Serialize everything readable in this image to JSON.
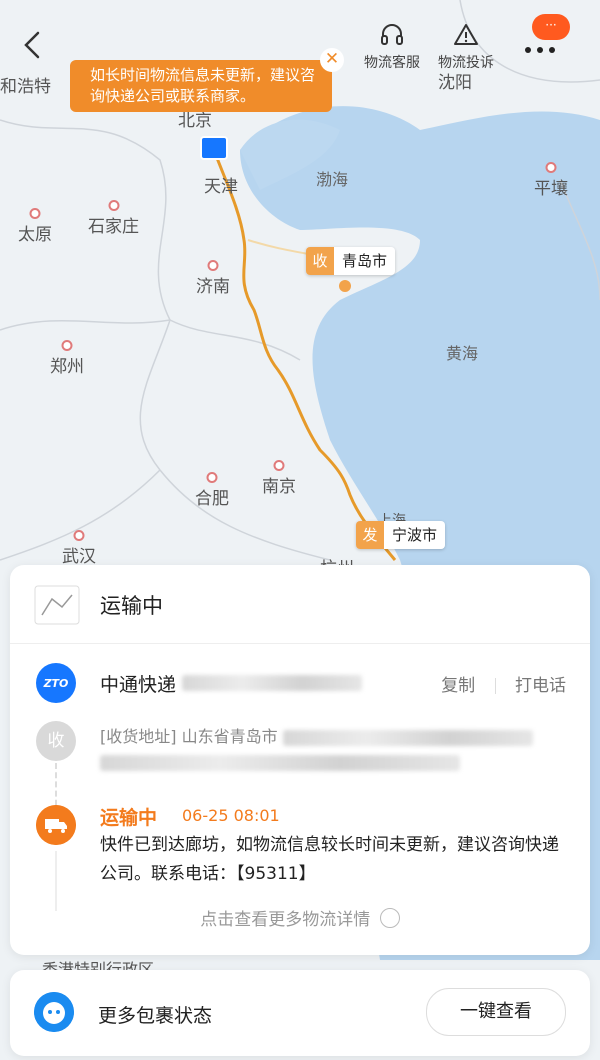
{
  "header": {
    "back_icon": "chevron-left-icon",
    "customer_service_label": "物流客服",
    "complaint_label": "物流投诉",
    "more_badge": "···"
  },
  "toast": {
    "message": "如长时间物流信息未更新，建议咨询快递公司或联系商家。",
    "close_icon": "close-icon"
  },
  "map": {
    "cities": [
      {
        "name": "和浩特"
      },
      {
        "name": "沈阳"
      },
      {
        "name": "北京"
      },
      {
        "name": "天津"
      },
      {
        "name": "平壤"
      },
      {
        "name": "太原"
      },
      {
        "name": "石家庄"
      },
      {
        "name": "济南"
      },
      {
        "name": "郑州"
      },
      {
        "name": "合肥"
      },
      {
        "name": "南京"
      },
      {
        "name": "武汉"
      },
      {
        "name": "杭州"
      },
      {
        "name": "上海"
      },
      {
        "name": "香港特别行政区"
      }
    ],
    "seas": {
      "bohai": "渤海",
      "huanghai": "黄海"
    },
    "destination": {
      "tag": "收",
      "name": "青岛市"
    },
    "origin": {
      "tag": "发",
      "name": "宁波市"
    },
    "route_color": "#e69a2a"
  },
  "card": {
    "status_title": "运输中",
    "courier": {
      "name": "中通快递",
      "copy_label": "复制",
      "call_label": "打电话",
      "logo_text": "ZTO"
    },
    "address": {
      "icon_label": "收",
      "prefix": "[收货地址] 山东省青岛市"
    },
    "latest": {
      "status": "运输中",
      "time": "06-25 08:01",
      "description": "快件已到达廊坊，如物流信息较长时间未更新，建议咨询快递公司。联系电话：【95311】"
    },
    "more_details": "点击查看更多物流详情"
  },
  "bottom": {
    "label": "更多包裹状态",
    "button": "一键查看"
  },
  "colors": {
    "accent": "#f37b1d",
    "toast": "#f08c2a",
    "marker": "#f2a34b",
    "logo_blue": "#1677ff"
  }
}
